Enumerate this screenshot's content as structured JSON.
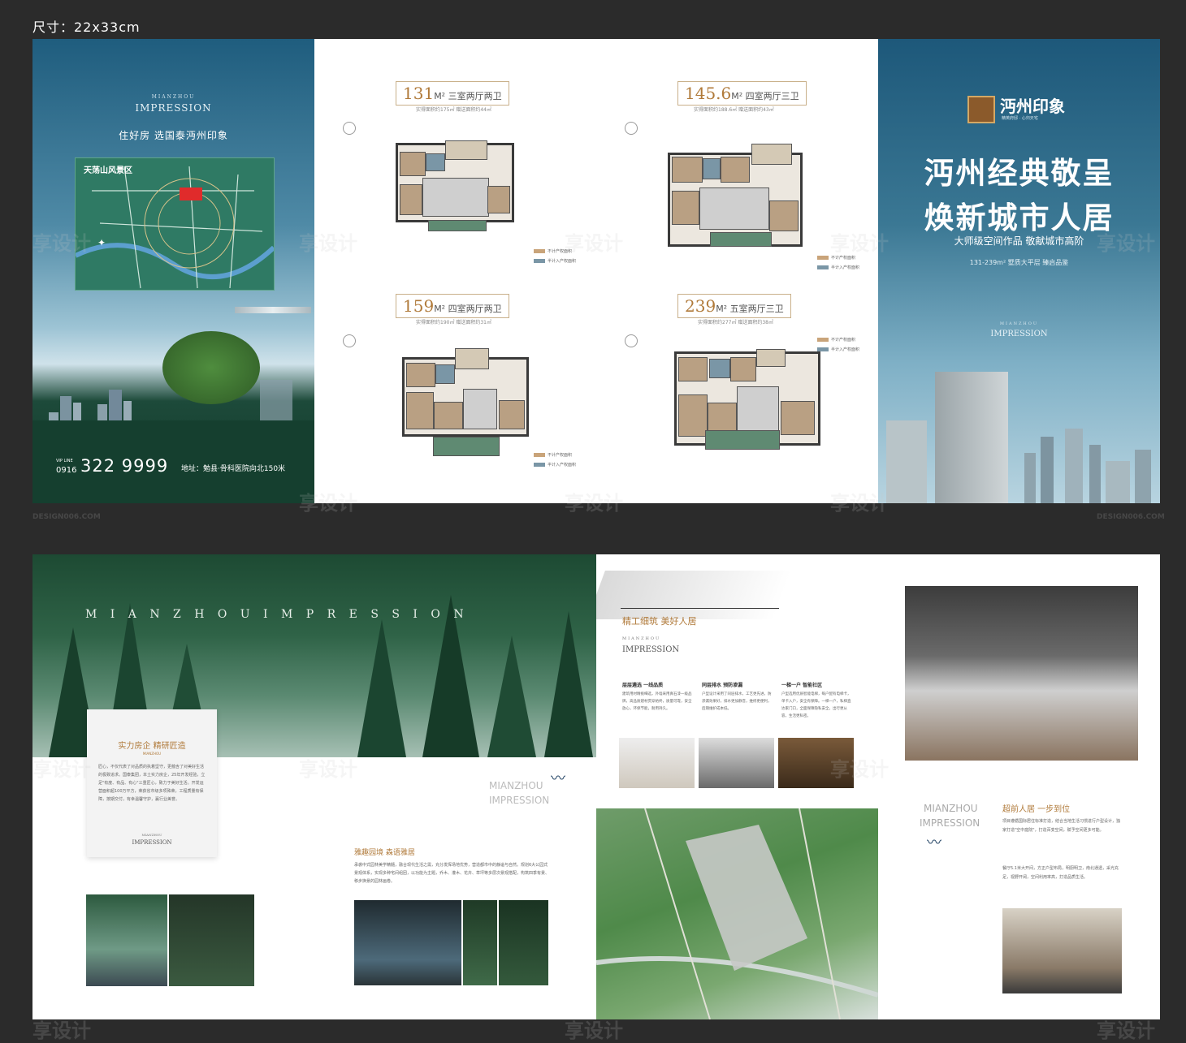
{
  "size_label": "尺寸：22x33cm",
  "watermark": "享设计",
  "watermark_url": "DESIGN006.COM",
  "cover_left": {
    "brand_en_top": "MIANZHOU",
    "brand_en": "IMPRESSION",
    "slogan": "住好房 选国泰沔州印象",
    "map_title": "天荡山风景区",
    "vip_label": "VIP LINE",
    "area_code": "0916",
    "phone": "322 9999",
    "address": "地址：勉县·骨科医院向北150米"
  },
  "plans": [
    {
      "area": "131",
      "unit": "M²",
      "rooms": "三室两厅两卫",
      "sub": "实得面积约175㎡ 赠送面积约44㎡"
    },
    {
      "area": "145.6",
      "unit": "M²",
      "rooms": "四室两厅三卫",
      "sub": "实得面积约188.6㎡ 赠送面积约43㎡"
    },
    {
      "area": "159",
      "unit": "M²",
      "rooms": "四室两厅两卫",
      "sub": "实得面积约190㎡ 赠送面积约31㎡"
    },
    {
      "area": "239",
      "unit": "M²",
      "rooms": "五室两厅三卫",
      "sub": "实得面积约277㎡ 赠送面积约38㎡"
    }
  ],
  "legend": {
    "a": "不计产权面积",
    "b": "半计入产权面积"
  },
  "cover_right": {
    "logo_text": "沔州印象",
    "logo_sub": "精英府邸 · 心归天宅",
    "headline_1": "沔州经典敬呈",
    "headline_2": "焕新城市人居",
    "tagline": "大师级空间作品 敬献城市高阶",
    "range": "131-239m² 墅质大平层 臻启品鉴",
    "brand_en_top": "MIANZHOU",
    "brand_en": "IMPRESSION"
  },
  "forest": {
    "banner": "M I A N Z H O U  I M P R E S S I O N",
    "card_title": "实力房企 精研匠造",
    "card_sub": "MIANZHOU",
    "card_brand_top": "MIANZHOU",
    "card_brand": "IMPRESSION",
    "card_body": "匠心，不仅代表了对品质的执着坚守，更蕴含了对美好生活的极致追求。国泰集团，本土实力房企，25年开发经验，立足\"有度、有品、有心\"三重匠心，致力于美好生活。开发运营面积超100万平方，荣获省市级多项殊荣，工程质量有保障，按期交付，有幸温馨守护，赢行业美誉。",
    "mz_top": "MIANZHOU",
    "mz_bottom": "IMPRESSION",
    "garden_title": "雅趣园境 森语雅居",
    "garden_body": "承袭中式园林美学精髓，融合现代生活之需，充分发挥场地优势，营造都市中的静谧与自然。规划6大公园式景观体系，实现多种宅间组团，以功能为主题，乔木、灌木、花卉、草坪等多层次景观搭配，构筑四季有景、移步换景的园林画卷。"
  },
  "quality": {
    "title": "精工细筑 美好人居",
    "brand_top": "MIANZHOU",
    "brand": "IMPRESSION",
    "col1_title": "层层遴选 一线品质",
    "col1_body": "建筑用材精挑细选，外墙采用真石漆一级品牌，高品质建材贯穿始终，质量可靠，安全放心，环保节能，耐用持久。",
    "col2_title": "同层排水 预防渗漏",
    "col2_body": "户型设计采用了同层排水，工艺更先进，防渗漏效果好，排水更加静音，维修更便利，后期维护成本低。",
    "col3_title": "一梯一户 智能社区",
    "col3_body": "户型选用优质智能电梯，每户配有电梯卡，单卡入户，安全有保障。一梯一户，私梯直达家门口，全面保障隐私安全，出行更从容，生活更私密。"
  },
  "interior": {
    "brand_top": "MIANZHOU",
    "brand": "IMPRESSION",
    "title": "超前人居 一步到位",
    "body1": "项目遵循国际居住标准打造，结合当地生活习惯进行户型设计，独家打造\"空中庭院\"，打造百变空间，赋予空间更多可能。",
    "body2": "餐厅5.1米大开间，方正户型布局，明厨明卫，南北通透，采光充足，视野开阔，空间利用率高，打造品质生活。"
  }
}
